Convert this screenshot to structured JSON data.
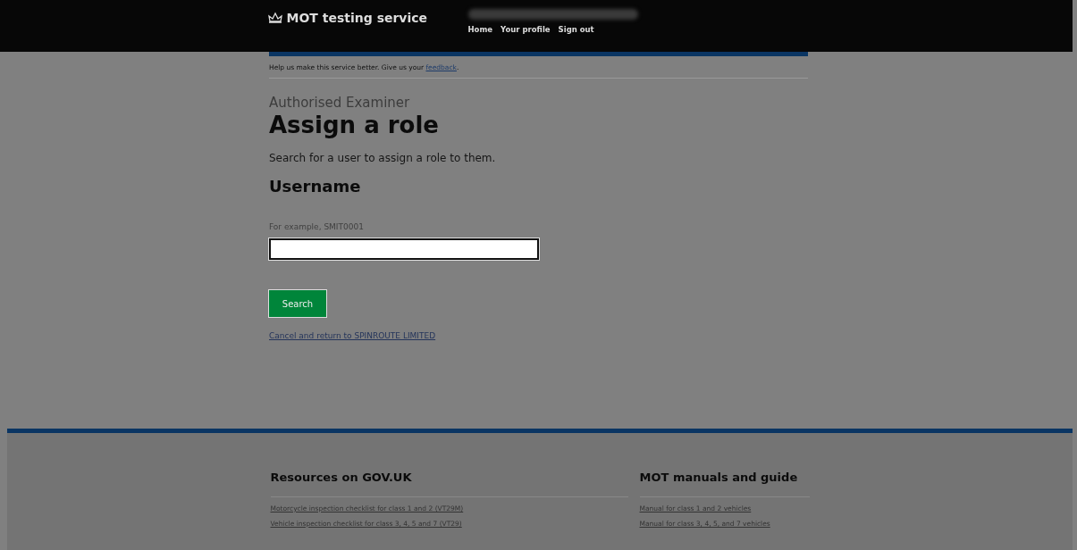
{
  "header": {
    "service_name": "MOT testing service",
    "nav": [
      "Home",
      "Your profile",
      "Sign out"
    ]
  },
  "feedback": {
    "text": "Help us make this service better. Give us your ",
    "link": "feedback",
    "end": "."
  },
  "caption": "Authorised Examiner",
  "title": "Assign a role",
  "intro": "Search for a user to assign a role to them.",
  "field": {
    "label": "Username",
    "hint": "For example, SMIT0001"
  },
  "button": "Search",
  "cancel_link": "Cancel and return to SPINROUTE LIMITED",
  "footer": {
    "columns": [
      {
        "heading": "Resources on GOV.UK",
        "links": [
          "Motorcycle inspection checklist for class 1 and 2 (VT29M)",
          "Vehicle inspection checklist for class 3, 4, 5 and 7 (VT29)"
        ]
      },
      {
        "heading": "MOT manuals and guide",
        "links": [
          "Manual for class 1 and 2 vehicles",
          "Manual for class 3, 4, 5, and 7 vehicles"
        ]
      }
    ]
  }
}
